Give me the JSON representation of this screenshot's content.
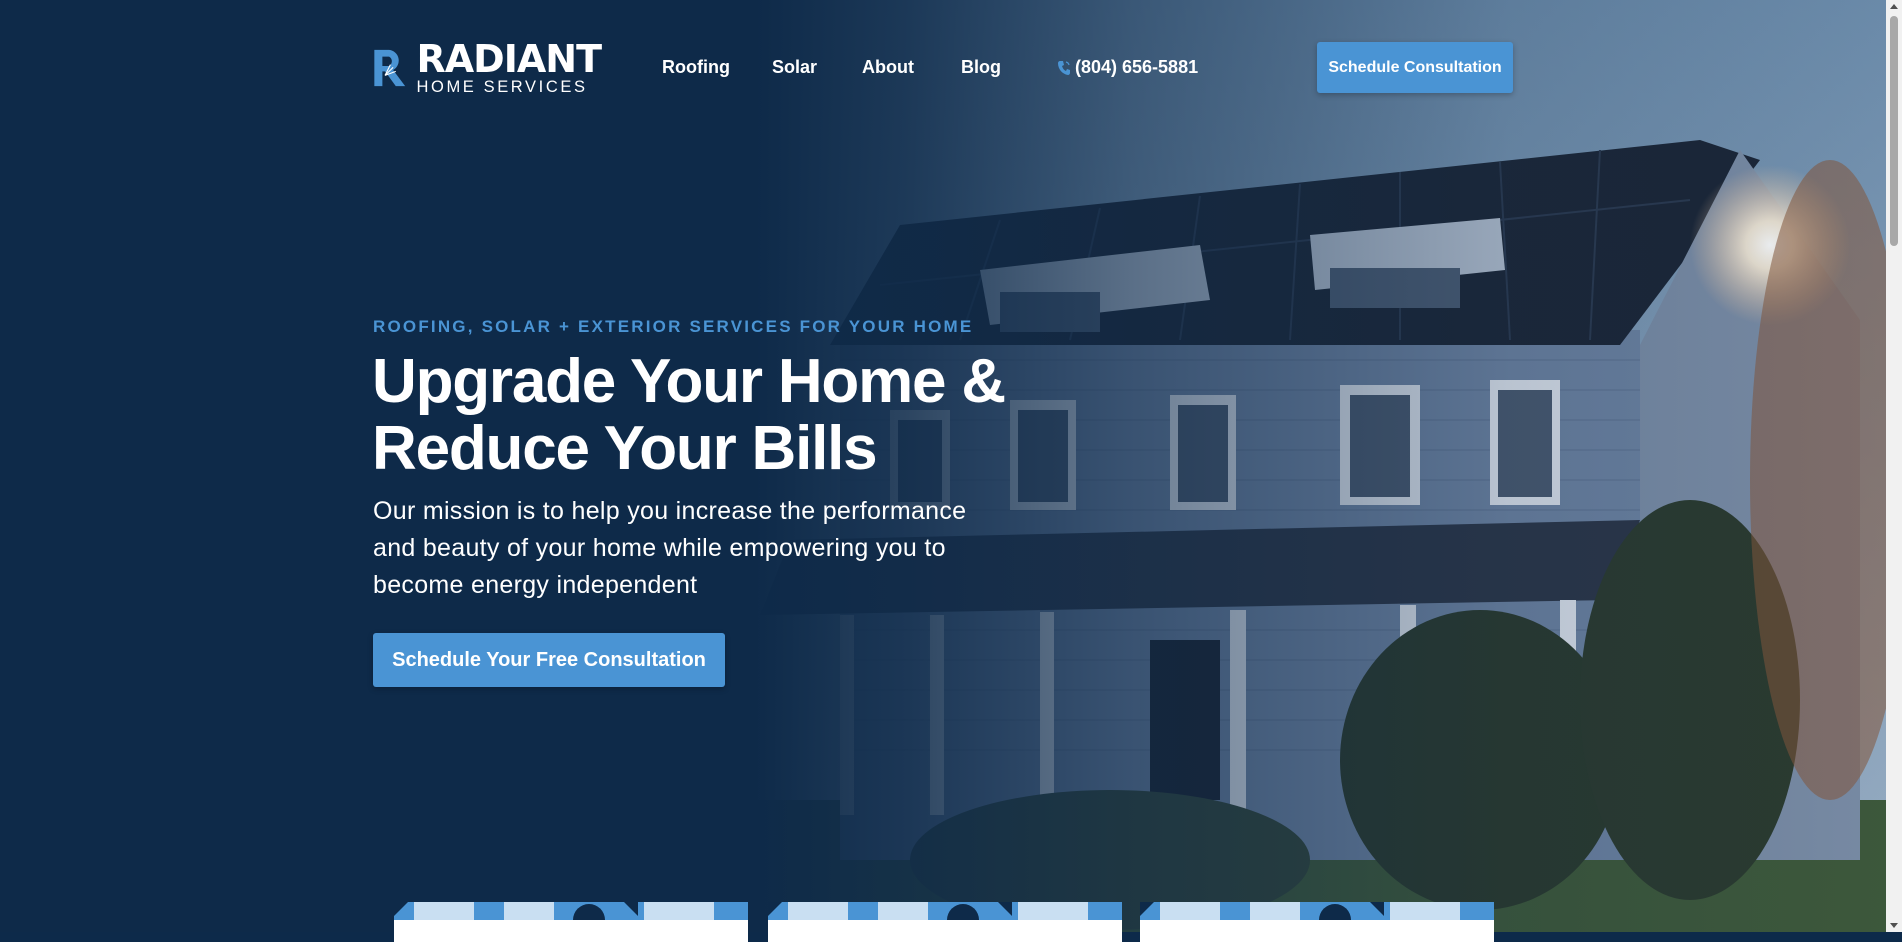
{
  "brand": {
    "name": "RADIANT",
    "tagline": "HOME SERVICES"
  },
  "nav": {
    "items": [
      {
        "label": "Roofing"
      },
      {
        "label": "Solar"
      },
      {
        "label": "About"
      },
      {
        "label": "Blog"
      }
    ],
    "phone": "(804) 656-5881",
    "phone_icon": "phone-icon",
    "cta_label": "Schedule Consultation"
  },
  "hero": {
    "eyebrow": "ROOFING, SOLAR + EXTERIOR SERVICES FOR YOUR HOME",
    "headline_line1": "Upgrade Your Home &",
    "headline_line2": "Reduce Your Bills",
    "subtext": "Our mission is to help you increase the performance and beauty of your home while empowering you to become energy independent",
    "cta_label": "Schedule Your Free Consultation"
  },
  "colors": {
    "navy": "#0e2a49",
    "accent": "#4a94d4",
    "white": "#ffffff"
  }
}
